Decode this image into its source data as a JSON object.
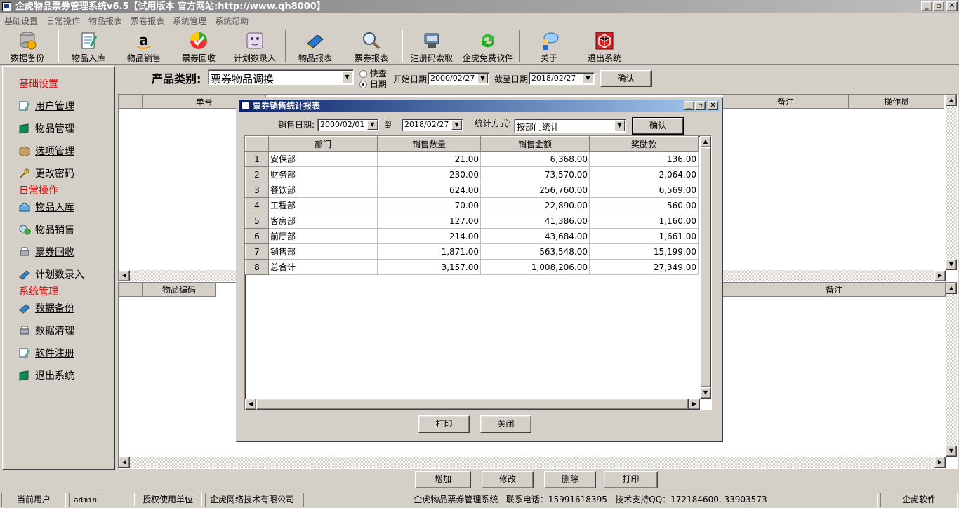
{
  "window": {
    "title": "企虎物品票券管理系统v6.5【试用版本 官方网站:http://www.qh8000】",
    "controls": {
      "minimize": "_",
      "maximize": "▫",
      "close": "✕"
    }
  },
  "menu": [
    "基础设置",
    "日常操作",
    "物品报表",
    "票卷报表",
    "系统管理",
    "系统帮助"
  ],
  "toolbar": [
    {
      "label": "数据备份",
      "icon": "database-backup-icon"
    },
    {
      "label": "物品入库",
      "icon": "stock-in-icon"
    },
    {
      "label": "物品销售",
      "icon": "sales-icon"
    },
    {
      "label": "票券回收",
      "icon": "ticket-recycle-icon"
    },
    {
      "label": "计划数录入",
      "icon": "plan-entry-icon"
    },
    {
      "label": "物品报表",
      "icon": "goods-report-icon"
    },
    {
      "label": "票券报表",
      "icon": "ticket-report-icon"
    },
    {
      "label": "注册码索取",
      "icon": "register-icon"
    },
    {
      "label": "企虎免费软件",
      "icon": "free-software-icon"
    },
    {
      "label": "关于",
      "icon": "about-icon"
    },
    {
      "label": "退出系统",
      "icon": "exit-icon"
    }
  ],
  "nav": {
    "sections": [
      {
        "title": "基础设置",
        "items": [
          "用户管理",
          "物品管理",
          "选项管理",
          "更改密码"
        ]
      },
      {
        "title": "日常操作",
        "items": [
          "物品入库",
          "物品销售",
          "票券回收",
          "计划数录入"
        ]
      },
      {
        "title": "系统管理",
        "items": [
          "数据备份",
          "数据清理",
          "软件注册",
          "退出系统"
        ]
      }
    ]
  },
  "filter": {
    "category_label": "产品类别:",
    "category_value": "票券物品调换",
    "radio_quick": "快查",
    "radio_date": "日期",
    "start_label": "开始日期",
    "start_value": "2000/02/27",
    "end_label": "截至日期",
    "end_value": "2018/02/27",
    "confirm": "确认"
  },
  "grid_top": {
    "headers": [
      "单号",
      "备注",
      "操作员"
    ]
  },
  "grid_bottom": {
    "headers": [
      "物品编码",
      "备注"
    ]
  },
  "dialog": {
    "title": "票券销售统计报表",
    "date_label": "销售日期:",
    "from": "2000/02/01",
    "to_label": "到",
    "to": "2018/02/27",
    "mode_label": "统计方式:",
    "mode_value": "按部门统计",
    "confirm": "确认",
    "print": "打印",
    "close": "关闭",
    "headers": [
      "部门",
      "销售数量",
      "销售金额",
      "奖励款"
    ],
    "rows": [
      {
        "no": "1",
        "dept": "安保部",
        "qty": "21.00",
        "amount": "6,368.00",
        "reward": "136.00"
      },
      {
        "no": "2",
        "dept": "财务部",
        "qty": "230.00",
        "amount": "73,570.00",
        "reward": "2,064.00"
      },
      {
        "no": "3",
        "dept": "餐饮部",
        "qty": "624.00",
        "amount": "256,760.00",
        "reward": "6,569.00"
      },
      {
        "no": "4",
        "dept": "工程部",
        "qty": "70.00",
        "amount": "22,890.00",
        "reward": "560.00"
      },
      {
        "no": "5",
        "dept": "客房部",
        "qty": "127.00",
        "amount": "41,386.00",
        "reward": "1,160.00"
      },
      {
        "no": "6",
        "dept": "前厅部",
        "qty": "214.00",
        "amount": "43,684.00",
        "reward": "1,661.00"
      },
      {
        "no": "7",
        "dept": "销售部",
        "qty": "1,871.00",
        "amount": "563,548.00",
        "reward": "15,199.00"
      },
      {
        "no": "8",
        "dept": "总合计",
        "qty": "3,157.00",
        "amount": "1,008,206.00",
        "reward": "27,349.00"
      }
    ]
  },
  "actions": [
    "增加",
    "修改",
    "删除",
    "打印"
  ],
  "status": {
    "user_label": "当前用户",
    "user": "admin",
    "licensee_label": "授权使用单位",
    "licensee": "企虎网络技术有限公司",
    "info": "企虎物品票券管理系统   联系电话：15991618395   技术支持QQ：172184600, 33903573",
    "brand": "企虎软件"
  }
}
